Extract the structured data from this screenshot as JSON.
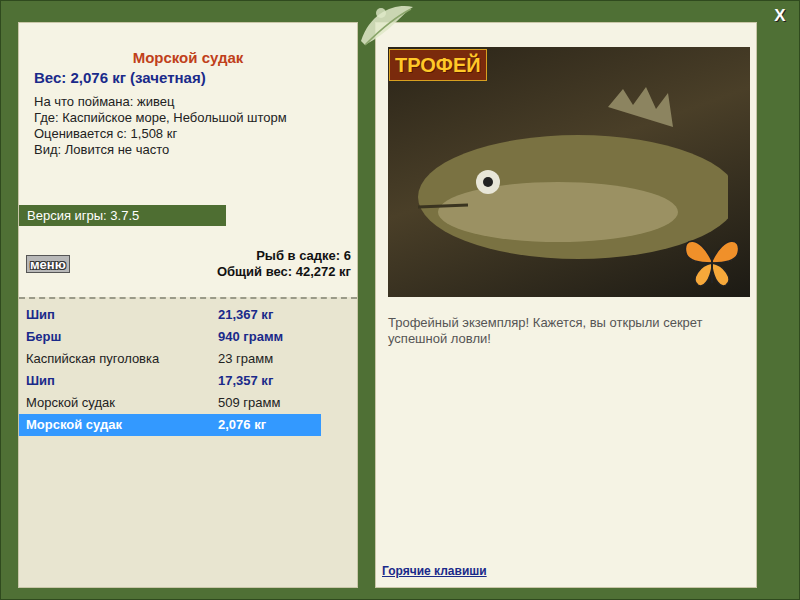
{
  "window": {
    "close_button": "X"
  },
  "fish_card": {
    "title": "Морской судак",
    "weight": "Вес: 2,076 кг (зачетная)",
    "details": [
      "На что поймана: живец",
      "Где: Каспийское море, Небольшой шторм",
      "Оценивается с: 1,508 кг",
      "Вид: Ловится не часто"
    ]
  },
  "version": "Версия игры: 3.7.5",
  "menu_button": "меню",
  "keepnet": {
    "count": "Рыб в садке: 6",
    "total": "Общий вес: 42,272 кг"
  },
  "catches": [
    {
      "name": "Шип",
      "weight": "21,367 кг",
      "trophy": true,
      "selected": false
    },
    {
      "name": "Берш",
      "weight": "940 грамм",
      "trophy": true,
      "selected": false
    },
    {
      "name": "Каспийская пуголовка",
      "weight": "23 грамм",
      "trophy": false,
      "selected": false
    },
    {
      "name": "Шип",
      "weight": "17,357 кг",
      "trophy": true,
      "selected": false
    },
    {
      "name": "Морской судак",
      "weight": "509 грамм",
      "trophy": false,
      "selected": false
    },
    {
      "name": "Морской судак",
      "weight": "2,076 кг",
      "trophy": true,
      "selected": true
    }
  ],
  "photo": {
    "badge": "ТРОФЕЙ"
  },
  "message": "Трофейный экземпляр! Кажется, вы открыли секрет успешной ловли!",
  "hotkeys_link": "Горячие клавиши"
}
